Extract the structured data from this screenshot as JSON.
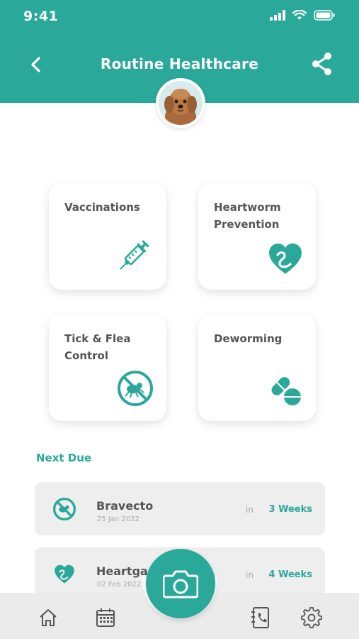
{
  "status": {
    "time": "9:41"
  },
  "header": {
    "title": "Routine Healthcare"
  },
  "cards": [
    {
      "label": "Vaccinations",
      "icon": "syringe-icon"
    },
    {
      "label": "Heartworm\nPrevention",
      "icon": "heart-icon"
    },
    {
      "label": "Tick & Flea\nControl",
      "icon": "no-flea-icon"
    },
    {
      "label": "Deworming",
      "icon": "pill-icon"
    }
  ],
  "next_due": {
    "title": "Next Due",
    "items": [
      {
        "name": "Bravecto",
        "date": "25 Jan 2022",
        "in": "in",
        "when": "3 Weeks",
        "icon": "no-flea-icon"
      },
      {
        "name": "Heartgard",
        "date": "02 Feb 2022",
        "in": "in",
        "when": "4 Weeks",
        "icon": "heart-icon"
      }
    ]
  },
  "tabs": [
    "home-icon",
    "calendar-icon",
    "camera-icon",
    "contacts-icon",
    "settings-icon"
  ],
  "colors": {
    "accent": "#2aa89a",
    "card_bg": "#ffffff",
    "row_bg": "#eeeeee",
    "tabbar_bg": "#ebebeb"
  }
}
